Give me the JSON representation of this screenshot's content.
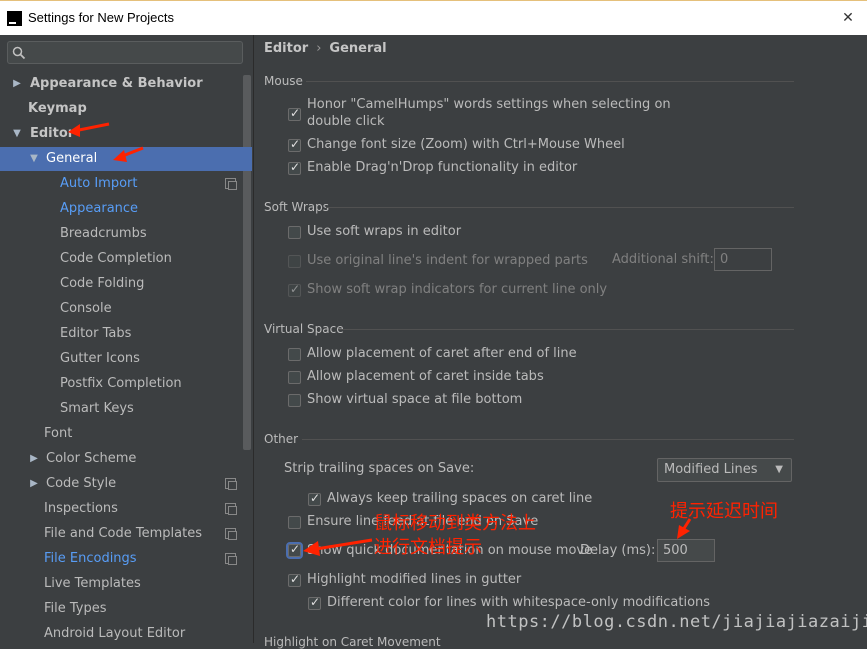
{
  "window": {
    "title": "Settings for New Projects"
  },
  "search": {
    "placeholder": ""
  },
  "tree": {
    "appearance_behavior": "Appearance & Behavior",
    "keymap": "Keymap",
    "editor": "Editor",
    "general": "General",
    "auto_import": "Auto Import",
    "appearance": "Appearance",
    "breadcrumbs": "Breadcrumbs",
    "code_completion": "Code Completion",
    "code_folding": "Code Folding",
    "console": "Console",
    "editor_tabs": "Editor Tabs",
    "gutter_icons": "Gutter Icons",
    "postfix_completion": "Postfix Completion",
    "smart_keys": "Smart Keys",
    "font": "Font",
    "color_scheme": "Color Scheme",
    "code_style": "Code Style",
    "inspections": "Inspections",
    "file_code_templates": "File and Code Templates",
    "file_encodings": "File Encodings",
    "live_templates": "Live Templates",
    "file_types": "File Types",
    "android_layout_editor": "Android Layout Editor"
  },
  "breadcrumb": {
    "parent": "Editor",
    "separator": "›",
    "current": "General"
  },
  "sections": {
    "mouse": "Mouse",
    "soft_wraps": "Soft Wraps",
    "virtual_space": "Virtual Space",
    "other": "Other",
    "highlight_caret": "Highlight on Caret Movement"
  },
  "mouse": {
    "camelhumps_line1": "Honor \"CamelHumps\" words settings when selecting on",
    "camelhumps_line2": "double click",
    "zoom": "Change font size (Zoom) with Ctrl+Mouse Wheel",
    "dragdrop": "Enable Drag'n'Drop functionality in editor"
  },
  "soft_wraps": {
    "use_soft_wraps": "Use soft wraps in editor",
    "use_original_indent": "Use original line's indent for wrapped parts",
    "additional_shift_label": "Additional shift:",
    "additional_shift_value": "0",
    "show_indicators": "Show soft wrap indicators for current line only"
  },
  "virtual_space": {
    "after_eol": "Allow placement of caret after end of line",
    "inside_tabs": "Allow placement of caret inside tabs",
    "file_bottom": "Show virtual space at file bottom"
  },
  "other": {
    "strip_label": "Strip trailing spaces on Save:",
    "strip_value": "Modified Lines",
    "keep_trailing": "Always keep trailing spaces on caret line",
    "ensure_lf": "Ensure line feed at file end on Save",
    "quick_doc": "Show quick documentation on mouse move",
    "delay_label": "Delay (ms):",
    "delay_value": "500",
    "highlight_modified": "Highlight modified lines in gutter",
    "different_color": "Different color for lines with whitespace-only modifications"
  },
  "annotations": {
    "hover_line1": "鼠标移动到类方法上",
    "hover_line2": "进行文档提示",
    "delay_note": "提示延迟时间"
  },
  "watermark": "https://blog.csdn.net/jiajiajiazaijia",
  "colors": {
    "selection": "#4b6eaf",
    "link": "#589df6",
    "annotation": "#ff2200",
    "background": "#3c3f41"
  }
}
